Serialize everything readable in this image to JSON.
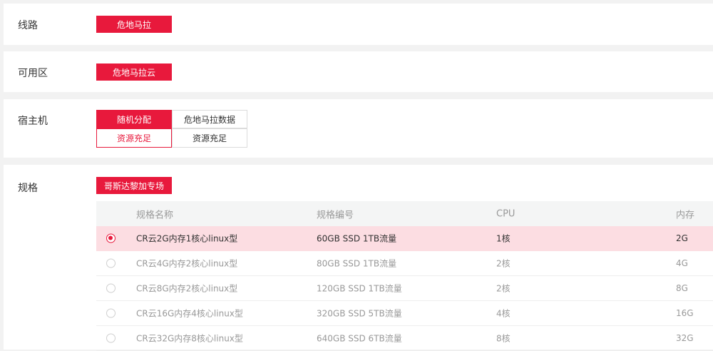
{
  "route": {
    "label": "线路",
    "option": "危地马拉"
  },
  "zone": {
    "label": "可用区",
    "option": "危地马拉云"
  },
  "host": {
    "label": "宿主机",
    "options": [
      {
        "name": "随机分配",
        "status": "资源充足"
      },
      {
        "name": "危地马拉数据",
        "status": "资源充足"
      }
    ]
  },
  "spec": {
    "label": "规格",
    "tag": "哥斯达黎加专场",
    "columns": [
      "规格名称",
      "规格编号",
      "CPU",
      "内存"
    ],
    "rows": [
      {
        "name": "CR云2G内存1核心linux型",
        "code": "60GB SSD 1TB流量",
        "cpu": "1核",
        "mem": "2G",
        "selected": true
      },
      {
        "name": "CR云4G内存2核心linux型",
        "code": "80GB SSD 1TB流量",
        "cpu": "2核",
        "mem": "4G",
        "selected": false
      },
      {
        "name": "CR云8G内存2核心linux型",
        "code": "120GB SSD 1TB流量",
        "cpu": "2核",
        "mem": "8G",
        "selected": false
      },
      {
        "name": "CR云16G内存4核心linux型",
        "code": "320GB SSD 5TB流量",
        "cpu": "4核",
        "mem": "16G",
        "selected": false
      },
      {
        "name": "CR云32G内存8核心linux型",
        "code": "640GB SSD 6TB流量",
        "cpu": "8核",
        "mem": "32G",
        "selected": false
      }
    ]
  },
  "colors": {
    "accent": "#e8193c",
    "selected_row": "#fcdde2"
  }
}
